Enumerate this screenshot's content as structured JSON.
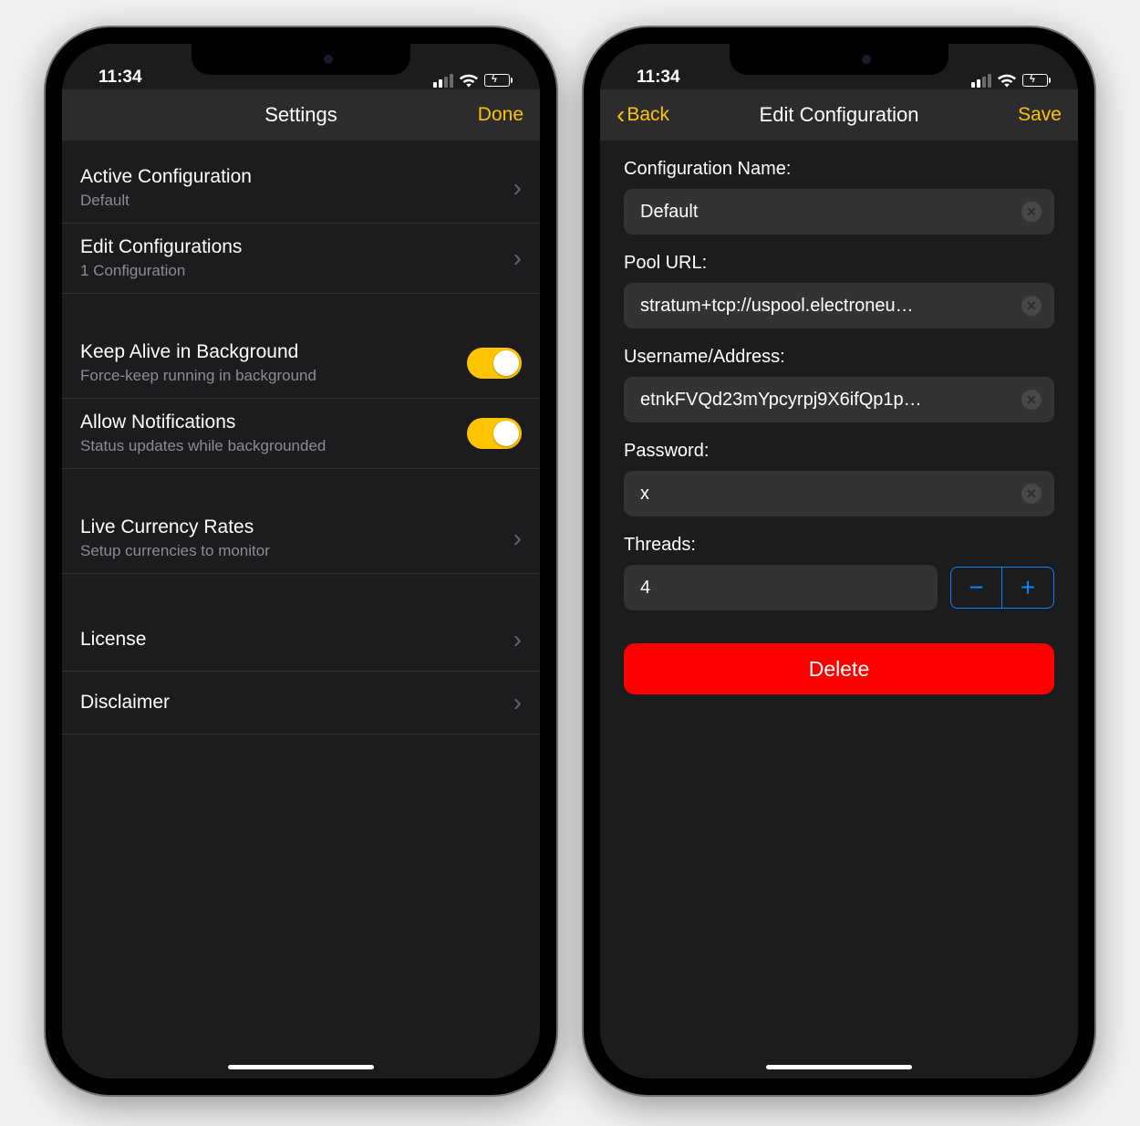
{
  "status": {
    "time": "11:34"
  },
  "colors": {
    "accent": "#ffc400",
    "danger": "#ff0000",
    "stepper": "#0a84ff"
  },
  "left": {
    "nav": {
      "title": "Settings",
      "done": "Done"
    },
    "rows": {
      "activeConfig": {
        "title": "Active Configuration",
        "subtitle": "Default"
      },
      "editConfigs": {
        "title": "Edit Configurations",
        "subtitle": "1 Configuration"
      },
      "keepAlive": {
        "title": "Keep Alive in Background",
        "subtitle": "Force-keep running in background"
      },
      "allowNotif": {
        "title": "Allow Notifications",
        "subtitle": "Status updates while backgrounded"
      },
      "liveRates": {
        "title": "Live Currency Rates",
        "subtitle": "Setup currencies to monitor"
      },
      "license": {
        "title": "License"
      },
      "disclaimer": {
        "title": "Disclaimer"
      }
    }
  },
  "right": {
    "nav": {
      "back": "Back",
      "title": "Edit Configuration",
      "save": "Save"
    },
    "form": {
      "nameLabel": "Configuration Name:",
      "nameValue": "Default",
      "poolLabel": "Pool URL:",
      "poolValue": "stratum+tcp://uspool.electroneu…",
      "userLabel": "Username/Address:",
      "userValue": "etnkFVQd23mYpcyrpj9X6ifQp1p…",
      "passLabel": "Password:",
      "passValue": "x",
      "threadsLabel": "Threads:",
      "threadsValue": "4",
      "delete": "Delete"
    }
  }
}
